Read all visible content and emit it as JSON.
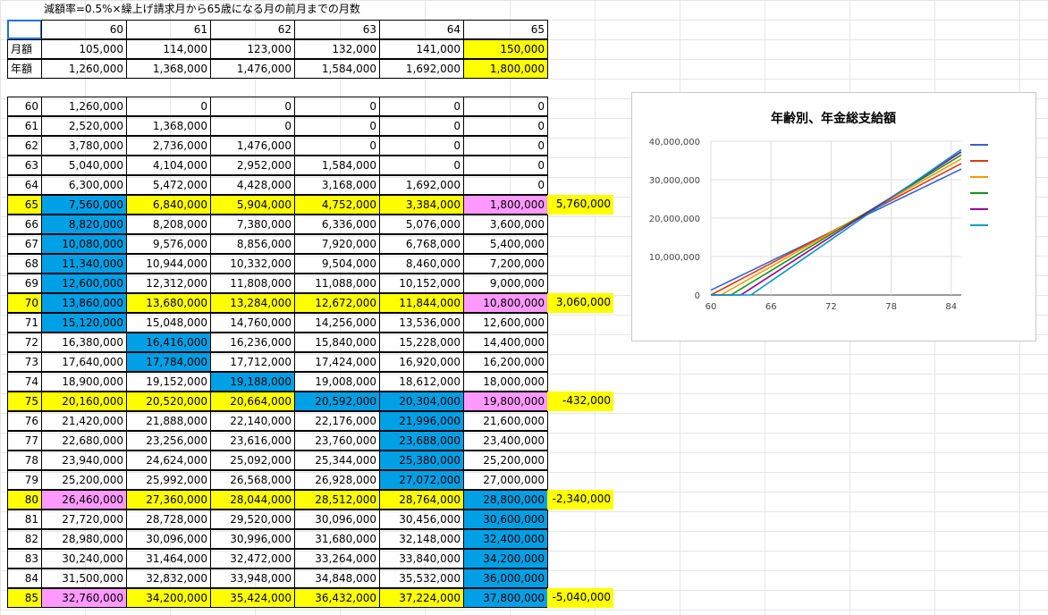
{
  "sheet": {
    "title": "減額率=0.5%×繰上げ請求月から65歳になる月の前月までの月数",
    "header_ages": [
      "60",
      "61",
      "62",
      "63",
      "64",
      "65"
    ],
    "monthly": {
      "label": "月額",
      "values": [
        "105,000",
        "114,000",
        "123,000",
        "132,000",
        "141,000",
        "150,000"
      ]
    },
    "annual": {
      "label": "年額",
      "values": [
        "1,260,000",
        "1,368,000",
        "1,476,000",
        "1,584,000",
        "1,692,000",
        "1,800,000"
      ]
    },
    "rows": [
      {
        "age": "60",
        "v": [
          "1,260,000",
          "0",
          "0",
          "0",
          "0",
          "0"
        ],
        "diff": ""
      },
      {
        "age": "61",
        "v": [
          "2,520,000",
          "1,368,000",
          "0",
          "0",
          "0",
          "0"
        ],
        "diff": ""
      },
      {
        "age": "62",
        "v": [
          "3,780,000",
          "2,736,000",
          "1,476,000",
          "0",
          "0",
          "0"
        ],
        "diff": ""
      },
      {
        "age": "63",
        "v": [
          "5,040,000",
          "4,104,000",
          "2,952,000",
          "1,584,000",
          "0",
          "0"
        ],
        "diff": ""
      },
      {
        "age": "64",
        "v": [
          "6,300,000",
          "5,472,000",
          "4,428,000",
          "3,168,000",
          "1,692,000",
          "0"
        ],
        "diff": ""
      },
      {
        "age": "65",
        "v": [
          "7,560,000",
          "6,840,000",
          "5,904,000",
          "4,752,000",
          "3,384,000",
          "1,800,000"
        ],
        "diff": "5,760,000"
      },
      {
        "age": "66",
        "v": [
          "8,820,000",
          "8,208,000",
          "7,380,000",
          "6,336,000",
          "5,076,000",
          "3,600,000"
        ],
        "diff": ""
      },
      {
        "age": "67",
        "v": [
          "10,080,000",
          "9,576,000",
          "8,856,000",
          "7,920,000",
          "6,768,000",
          "5,400,000"
        ],
        "diff": ""
      },
      {
        "age": "68",
        "v": [
          "11,340,000",
          "10,944,000",
          "10,332,000",
          "9,504,000",
          "8,460,000",
          "7,200,000"
        ],
        "diff": ""
      },
      {
        "age": "69",
        "v": [
          "12,600,000",
          "12,312,000",
          "11,808,000",
          "11,088,000",
          "10,152,000",
          "9,000,000"
        ],
        "diff": ""
      },
      {
        "age": "70",
        "v": [
          "13,860,000",
          "13,680,000",
          "13,284,000",
          "12,672,000",
          "11,844,000",
          "10,800,000"
        ],
        "diff": "3,060,000"
      },
      {
        "age": "71",
        "v": [
          "15,120,000",
          "15,048,000",
          "14,760,000",
          "14,256,000",
          "13,536,000",
          "12,600,000"
        ],
        "diff": ""
      },
      {
        "age": "72",
        "v": [
          "16,380,000",
          "16,416,000",
          "16,236,000",
          "15,840,000",
          "15,228,000",
          "14,400,000"
        ],
        "diff": ""
      },
      {
        "age": "73",
        "v": [
          "17,640,000",
          "17,784,000",
          "17,712,000",
          "17,424,000",
          "16,920,000",
          "16,200,000"
        ],
        "diff": ""
      },
      {
        "age": "74",
        "v": [
          "18,900,000",
          "19,152,000",
          "19,188,000",
          "19,008,000",
          "18,612,000",
          "18,000,000"
        ],
        "diff": ""
      },
      {
        "age": "75",
        "v": [
          "20,160,000",
          "20,520,000",
          "20,664,000",
          "20,592,000",
          "20,304,000",
          "19,800,000"
        ],
        "diff": "-432,000"
      },
      {
        "age": "76",
        "v": [
          "21,420,000",
          "21,888,000",
          "22,140,000",
          "22,176,000",
          "21,996,000",
          "21,600,000"
        ],
        "diff": ""
      },
      {
        "age": "77",
        "v": [
          "22,680,000",
          "23,256,000",
          "23,616,000",
          "23,760,000",
          "23,688,000",
          "23,400,000"
        ],
        "diff": ""
      },
      {
        "age": "78",
        "v": [
          "23,940,000",
          "24,624,000",
          "25,092,000",
          "25,344,000",
          "25,380,000",
          "25,200,000"
        ],
        "diff": ""
      },
      {
        "age": "79",
        "v": [
          "25,200,000",
          "25,992,000",
          "26,568,000",
          "26,928,000",
          "27,072,000",
          "27,000,000"
        ],
        "diff": ""
      },
      {
        "age": "80",
        "v": [
          "26,460,000",
          "27,360,000",
          "28,044,000",
          "28,512,000",
          "28,764,000",
          "28,800,000"
        ],
        "diff": "-2,340,000"
      },
      {
        "age": "81",
        "v": [
          "27,720,000",
          "28,728,000",
          "29,520,000",
          "30,096,000",
          "30,456,000",
          "30,600,000"
        ],
        "diff": ""
      },
      {
        "age": "82",
        "v": [
          "28,980,000",
          "30,096,000",
          "30,996,000",
          "31,680,000",
          "32,148,000",
          "32,400,000"
        ],
        "diff": ""
      },
      {
        "age": "83",
        "v": [
          "30,240,000",
          "31,464,000",
          "32,472,000",
          "33,264,000",
          "33,840,000",
          "34,200,000"
        ],
        "diff": ""
      },
      {
        "age": "84",
        "v": [
          "31,500,000",
          "32,832,000",
          "33,948,000",
          "34,848,000",
          "35,532,000",
          "36,000,000"
        ],
        "diff": ""
      },
      {
        "age": "85",
        "v": [
          "32,760,000",
          "34,200,000",
          "35,424,000",
          "36,432,000",
          "37,224,000",
          "37,800,000"
        ],
        "diff": "-5,040,000"
      }
    ],
    "colors": {
      "yellow": "#ffff00",
      "blue": "#00a0e6",
      "pink": "#ff99ff"
    },
    "highlight_rows": [
      "65",
      "70",
      "75",
      "80",
      "85"
    ]
  },
  "chart_data": {
    "type": "line",
    "title": "年齢別、年金総支給額",
    "x": [
      60,
      61,
      62,
      63,
      64,
      65,
      66,
      67,
      68,
      69,
      70,
      71,
      72,
      73,
      74,
      75,
      76,
      77,
      78,
      79,
      80,
      81,
      82,
      83,
      84,
      85
    ],
    "xticks": [
      "60",
      "66",
      "72",
      "78",
      "84"
    ],
    "yticks": [
      "0",
      "10,000,000",
      "20,000,000",
      "30,000,000",
      "40,000,000"
    ],
    "ylim": [
      0,
      40000000
    ],
    "xlim": [
      60,
      85
    ],
    "grid": true,
    "legend": "right",
    "series": [
      {
        "color": "#3366cc",
        "values": [
          1260000,
          2520000,
          3780000,
          5040000,
          6300000,
          7560000,
          8820000,
          10080000,
          11340000,
          12600000,
          13860000,
          15120000,
          16380000,
          17640000,
          18900000,
          20160000,
          21420000,
          22680000,
          23940000,
          25200000,
          26460000,
          27720000,
          28980000,
          30240000,
          31500000,
          32760000
        ]
      },
      {
        "color": "#dc3912",
        "values": [
          0,
          1368000,
          2736000,
          4104000,
          5472000,
          6840000,
          8208000,
          9576000,
          10944000,
          12312000,
          13680000,
          15048000,
          16416000,
          17784000,
          19152000,
          20520000,
          21888000,
          23256000,
          24624000,
          25992000,
          27360000,
          28728000,
          30096000,
          31464000,
          32832000,
          34200000
        ]
      },
      {
        "color": "#ff9900",
        "values": [
          0,
          0,
          1476000,
          2952000,
          4428000,
          5904000,
          7380000,
          8856000,
          10332000,
          11808000,
          13284000,
          14760000,
          16236000,
          17712000,
          19188000,
          20664000,
          22140000,
          23616000,
          25092000,
          26568000,
          28044000,
          29520000,
          30996000,
          32472000,
          33948000,
          35424000
        ]
      },
      {
        "color": "#109618",
        "values": [
          0,
          0,
          0,
          1584000,
          3168000,
          4752000,
          6336000,
          7920000,
          9504000,
          11088000,
          12672000,
          14256000,
          15840000,
          17424000,
          19008000,
          20592000,
          22176000,
          23760000,
          25344000,
          26928000,
          28512000,
          30096000,
          31680000,
          33264000,
          34848000,
          36432000
        ]
      },
      {
        "color": "#990099",
        "values": [
          0,
          0,
          0,
          0,
          1692000,
          3384000,
          5076000,
          6768000,
          8460000,
          10152000,
          11844000,
          13536000,
          15228000,
          16920000,
          18612000,
          20304000,
          21996000,
          23688000,
          25380000,
          27072000,
          28764000,
          30456000,
          32148000,
          33840000,
          35532000,
          37224000
        ]
      },
      {
        "color": "#0099c6",
        "values": [
          0,
          0,
          0,
          0,
          0,
          1800000,
          3600000,
          5400000,
          7200000,
          9000000,
          10800000,
          12600000,
          14400000,
          16200000,
          18000000,
          19800000,
          21600000,
          23400000,
          25200000,
          27000000,
          28800000,
          30600000,
          32400000,
          34200000,
          36000000,
          37800000
        ]
      }
    ]
  }
}
